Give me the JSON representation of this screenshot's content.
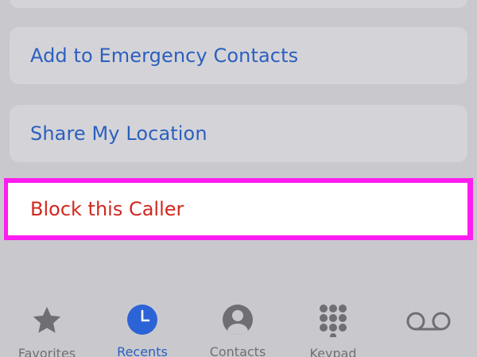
{
  "list": {
    "emergency_label": "Add to Emergency Contacts",
    "location_label": "Share My Location",
    "block_label": "Block this Caller"
  },
  "tabbar": {
    "favorites_label": "Favorites",
    "recents_label": "Recents",
    "contacts_label": "Contacts",
    "keypad_label": "Keypad",
    "voicemail_label": ""
  },
  "colors": {
    "link_blue": "#2c5fbf",
    "destructive_red": "#d2281f",
    "highlight_magenta": "#ff1cf0",
    "inactive_gray": "#707075"
  },
  "icons": {
    "favorites": "star-icon",
    "recents": "clock-icon",
    "contacts": "person-circle-icon",
    "keypad": "keypad-grid-icon",
    "voicemail": "voicemail-icon"
  }
}
